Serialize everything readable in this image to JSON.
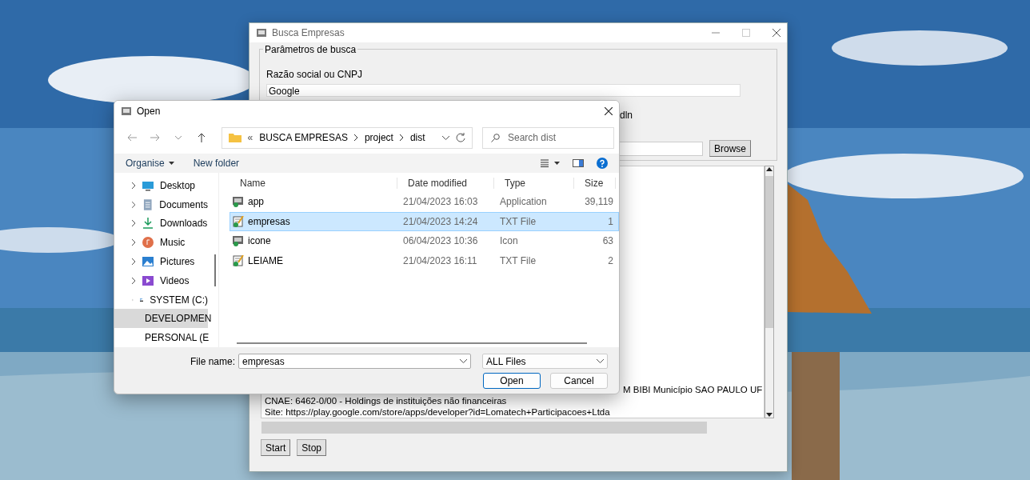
{
  "main_window": {
    "title": "Busca Empresas",
    "group_title": "Parâmetros de busca",
    "search_label": "Razão social ou CNPJ",
    "search_value": "Google",
    "option_label": "dln",
    "browse_button": "Browse",
    "output_lines": [
      "M BIBI Município SAO PAULO UF",
      "CNAE: 6462-0/00 - Holdings de instituições não financeiras",
      "Site: https://play.google.com/store/apps/developer?id=Lomatech+Participacoes+Ltda"
    ],
    "progress": {
      "level": 0
    },
    "buttons": [
      "Start",
      "Stop"
    ]
  },
  "dialog": {
    "title": "Open",
    "address_prefix": "«",
    "address": [
      "BUSCA EMPRESAS",
      "project",
      "dist"
    ],
    "search": {
      "placeholder": "Search dist"
    },
    "toolbar": [
      "Organise",
      "New folder"
    ],
    "nav_items": [
      {
        "label": "Desktop",
        "kind": "desktop",
        "selected": false
      },
      {
        "label": "Documents",
        "kind": "documents",
        "selected": false
      },
      {
        "label": "Downloads",
        "kind": "downloads",
        "selected": false
      },
      {
        "label": "Music",
        "kind": "music",
        "selected": false
      },
      {
        "label": "Pictures",
        "kind": "pictures",
        "selected": false
      },
      {
        "label": "Videos",
        "kind": "videos",
        "selected": false
      },
      {
        "label": "SYSTEM (C:)",
        "kind": "system",
        "selected": false
      },
      {
        "label": "DEVELOPMEN",
        "kind": "drive",
        "selected": true
      },
      {
        "label": "PERSONAL (E",
        "kind": "drive",
        "selected": false
      }
    ],
    "columns": [
      "Name",
      "Date modified",
      "Type",
      "Size"
    ],
    "files": [
      {
        "name": "app",
        "modified": "21/04/2023 16:03",
        "type": "Application",
        "size": "39,119",
        "kind": "app",
        "selected": false
      },
      {
        "name": "empresas",
        "modified": "21/04/2023 14:24",
        "type": "TXT File",
        "size": "1",
        "kind": "text",
        "selected": true
      },
      {
        "name": "icone",
        "modified": "06/04/2023 10:36",
        "type": "Icon",
        "size": "63",
        "kind": "app",
        "selected": false
      },
      {
        "name": "LEIAME",
        "modified": "21/04/2023 16:11",
        "type": "TXT File",
        "size": "2",
        "kind": "text",
        "selected": false
      }
    ],
    "file_name_label": "File name:",
    "file_name": "empresas",
    "file_type": "ALL Files",
    "buttons": [
      "Open",
      "Cancel"
    ]
  }
}
